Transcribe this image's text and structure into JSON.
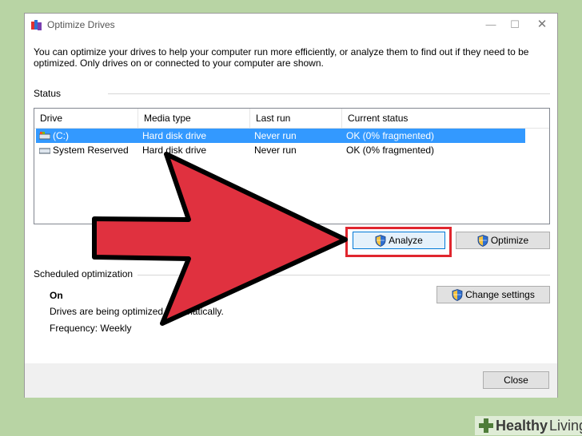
{
  "window": {
    "title": "Optimize Drives",
    "controls": {
      "minimize": "—",
      "maximize": "☐",
      "close": "✕"
    }
  },
  "intro": "You can optimize your drives to help your computer run more efficiently, or analyze them to find out if they need to be optimized. Only drives on or connected to your computer are shown.",
  "status": {
    "label": "Status",
    "columns": [
      "Drive",
      "Media type",
      "Last run",
      "Current status"
    ],
    "rows": [
      {
        "drive": "(C:)",
        "media_type": "Hard disk drive",
        "last_run": "Never run",
        "current_status": "OK (0% fragmented)",
        "selected": true
      },
      {
        "drive": "System Reserved",
        "media_type": "Hard disk drive",
        "last_run": "Never run",
        "current_status": "OK (0% fragmented)",
        "selected": false
      }
    ]
  },
  "buttons": {
    "analyze": "Analyze",
    "optimize": "Optimize",
    "change_settings": "Change settings",
    "close": "Close"
  },
  "scheduled": {
    "label": "Scheduled optimization",
    "state": "On",
    "description": "Drives are being optimized automatically.",
    "frequency": "Frequency: Weekly"
  },
  "watermark": {
    "prefix": "Healthy",
    "suffix": "Living"
  },
  "colors": {
    "selection": "#3399ff",
    "arrow": "#e0313f",
    "highlight_box": "#e0262e",
    "background": "#b8d4a4"
  },
  "icons": {
    "app": "defrag-icon",
    "drive": "hard-drive-icon",
    "uac": "uac-shield-icon",
    "watermark": "plus-icon"
  }
}
